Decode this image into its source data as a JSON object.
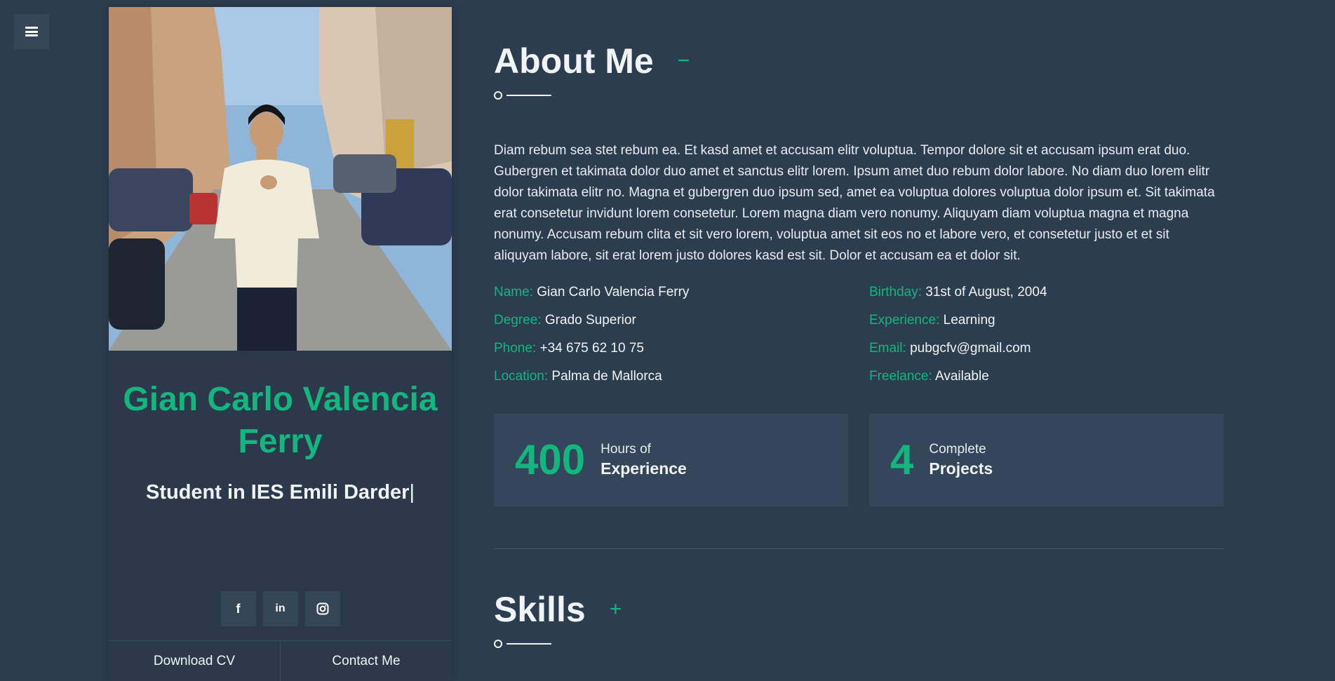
{
  "menu": {
    "icon": "hamburger-menu-icon"
  },
  "profile": {
    "name": "Gian Carlo Valencia Ferry",
    "role": "Student in IES Emili Darder",
    "cursor": "|",
    "socials": [
      {
        "icon": "facebook-icon",
        "glyph": "f"
      },
      {
        "icon": "linkedin-icon",
        "glyph": "in"
      },
      {
        "icon": "instagram-icon",
        "glyph": ""
      }
    ],
    "actions": {
      "download": "Download CV",
      "contact": "Contact Me"
    }
  },
  "about": {
    "title": "About Me",
    "toggle": "−",
    "text": "Diam rebum sea stet rebum ea. Et kasd amet et accusam elitr voluptua. Tempor dolore sit et accusam ipsum erat duo. Gubergren et takimata dolor duo amet et sanctus elitr lorem. Ipsum amet duo rebum dolor labore. No diam duo lorem elitr dolor takimata elitr no. Magna et gubergren duo ipsum sed, amet ea voluptua dolores voluptua dolor ipsum et. Sit takimata erat consetetur invidunt lorem consetetur. Lorem magna diam vero nonumy. Aliquyam diam voluptua magna et magna nonumy. Accusam rebum clita et sit vero lorem, voluptua amet sit eos no et labore vero, et consetetur justo et et sit aliquyam labore, sit erat lorem justo dolores kasd est sit. Dolor et accusam ea et dolor sit.",
    "info": [
      {
        "key": "Name:",
        "value": "Gian Carlo Valencia Ferry"
      },
      {
        "key": "Birthday:",
        "value": "31st of August, 2004"
      },
      {
        "key": "Degree:",
        "value": "Grado Superior"
      },
      {
        "key": "Experience:",
        "value": "Learning"
      },
      {
        "key": "Phone:",
        "value": "+34 675 62 10 75"
      },
      {
        "key": "Email:",
        "value": "pubgcfv@gmail.com"
      },
      {
        "key": "Location:",
        "value": "Palma de Mallorca"
      },
      {
        "key": "Freelance:",
        "value": "Available"
      }
    ],
    "stats": [
      {
        "num": "400",
        "line1": "Hours of",
        "line2": "Experience"
      },
      {
        "num": "4",
        "line1": "Complete",
        "line2": "Projects"
      }
    ]
  },
  "skills": {
    "title": "Skills",
    "toggle": "+"
  },
  "colors": {
    "accent": "#13b67f",
    "background": "#2d3d50",
    "card": "#34465a"
  }
}
